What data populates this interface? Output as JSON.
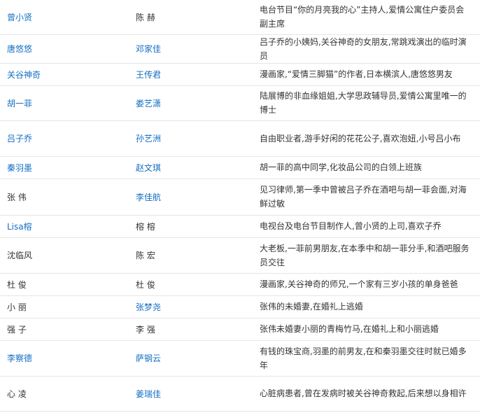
{
  "rows": [
    {
      "role": "曾小贤",
      "role_link": true,
      "actor": "陈 赫",
      "actor_link": false,
      "desc": "电台节目“你的月亮我的心”主持人,爱情公寓住户委员会副主席"
    },
    {
      "role": "唐悠悠",
      "role_link": true,
      "actor": "邓家佳",
      "actor_link": true,
      "desc": "吕子乔的小姨妈,关谷神奇的女朋友,常跳戏演出的临时演员"
    },
    {
      "role": "关谷神奇",
      "role_link": true,
      "actor": "王传君",
      "actor_link": true,
      "desc": "漫画家,“爱情三脚猫”的作者,日本横滨人,唐悠悠男友"
    },
    {
      "role": "胡一菲",
      "role_link": true,
      "actor": "娄艺潇",
      "actor_link": true,
      "desc": "陆展博的非血缘姐姐,大学思政辅导员,爱情公寓里唯一的博士"
    },
    {
      "role": "吕子乔",
      "role_link": true,
      "actor": "孙艺洲",
      "actor_link": true,
      "desc": "自由职业者,游手好闲的花花公子,喜欢泡妞,小号吕小布"
    },
    {
      "role": "秦羽墨",
      "role_link": true,
      "actor": "赵文琪",
      "actor_link": true,
      "desc": "胡一菲的高中同学,化妆品公司的白领上班族"
    },
    {
      "role": "张 伟",
      "role_link": false,
      "actor": "李佳航",
      "actor_link": true,
      "desc": "见习律师,第一季中曾被吕子乔在酒吧与胡一菲会面,对海鲜过敏"
    },
    {
      "role": "Lisa榕",
      "role_link": true,
      "actor": "榕 榕",
      "actor_link": false,
      "desc": "电视台及电台节目制作人,曾小贤的上司,喜欢子乔"
    },
    {
      "role": "沈临风",
      "role_link": false,
      "actor": "陈 宏",
      "actor_link": false,
      "desc": "大老板,一菲前男朋友,在本季中和胡一菲分手,和酒吧服务员交往"
    },
    {
      "role": "杜 俊",
      "role_link": false,
      "actor": "杜 俊",
      "actor_link": false,
      "desc": "漫画家,关谷神奇的师兄,一个家有三岁小孩的单身爸爸"
    },
    {
      "role": "小 丽",
      "role_link": false,
      "actor": "张梦尧",
      "actor_link": true,
      "desc": "张伟的未婚妻,在婚礼上逃婚"
    },
    {
      "role": "强 子",
      "role_link": false,
      "actor": "李 强",
      "actor_link": false,
      "desc": "张伟未婚妻小丽的青梅竹马,在婚礼上和小丽逃婚"
    },
    {
      "role": "李察德",
      "role_link": true,
      "actor": "萨钢云",
      "actor_link": true,
      "desc": "有钱的珠宝商,羽墨的前男友,在和秦羽墨交往时就已婚多年"
    },
    {
      "role": "心 凌",
      "role_link": false,
      "actor": "姜瑞佳",
      "actor_link": true,
      "desc": "心脏病患者,曾在发病时被关谷神奇救起,后来想以身相许"
    }
  ],
  "colors": {
    "link": "#136ec2",
    "text": "#333333",
    "border": "#e6e6e6"
  }
}
